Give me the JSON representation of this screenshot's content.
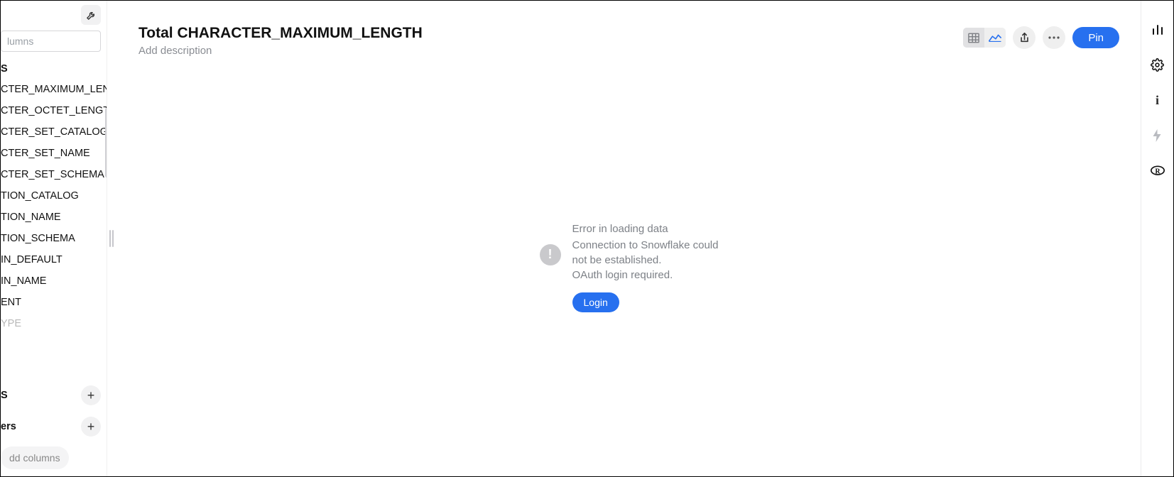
{
  "sidebar": {
    "search_placeholder": "lumns",
    "section_header": "S",
    "columns": [
      "CTER_MAXIMUM_LEN",
      "CTER_OCTET_LENGTH",
      "CTER_SET_CATALOG",
      "CTER_SET_NAME",
      "CTER_SET_SCHEMA",
      "TION_CATALOG",
      "TION_NAME",
      "TION_SCHEMA",
      "IN_DEFAULT",
      "IN_NAME",
      "ENT",
      "YPE"
    ],
    "group_s_label": "S",
    "group_ers_label": "ers",
    "add_columns_label": "dd columns"
  },
  "header": {
    "title": "Total CHARACTER_MAXIMUM_LENGTH",
    "subtitle": "Add description",
    "pin_label": "Pin"
  },
  "error": {
    "title": "Error in loading data",
    "line1": "Connection to Snowflake could",
    "line2": "not be established.",
    "line3": "OAuth login required.",
    "login_label": "Login"
  }
}
